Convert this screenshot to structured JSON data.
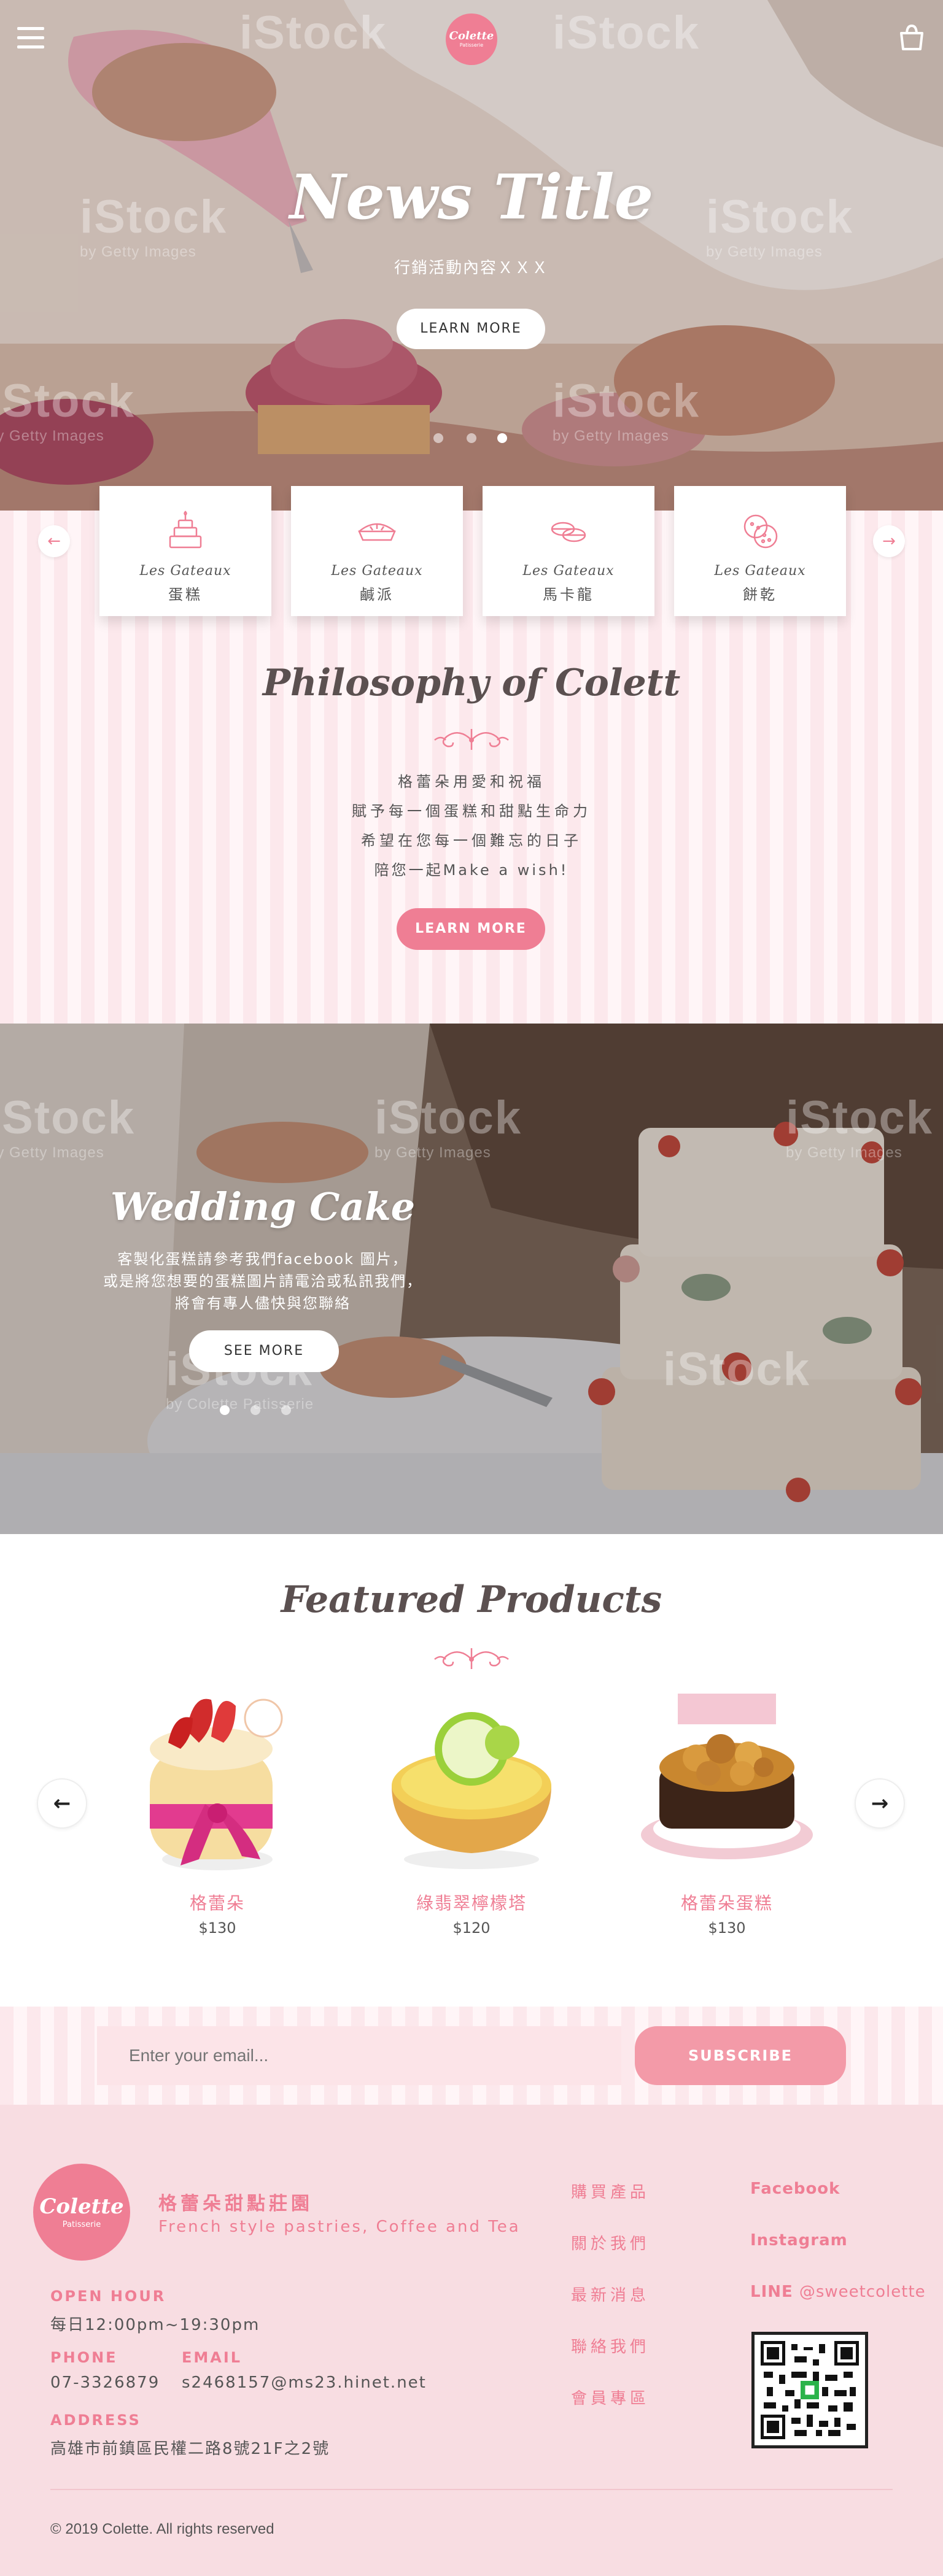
{
  "header": {
    "menu_icon": "hamburger-menu-icon",
    "logo_text": "Colette",
    "logo_sub": "Patisserie",
    "bag_icon": "shopping-bag-icon"
  },
  "hero": {
    "title": "News Title",
    "subtitle": "行銷活動內容ＸＸＸ",
    "button": "LEARN MORE",
    "watermark": "iStock",
    "watermark_sub": "by Getty Images",
    "slides": 3,
    "active_slide": 3
  },
  "categories": {
    "prev_icon": "arrow-left-icon",
    "next_icon": "arrow-right-icon",
    "items": [
      {
        "fr": "Les Gateaux",
        "zh": "蛋糕",
        "icon": "cake-icon"
      },
      {
        "fr": "Les Gateaux",
        "zh": "鹹派",
        "icon": "pie-icon"
      },
      {
        "fr": "Les Gateaux",
        "zh": "馬卡龍",
        "icon": "macaron-icon"
      },
      {
        "fr": "Les Gateaux",
        "zh": "餅乾",
        "icon": "cookie-icon"
      }
    ]
  },
  "philosophy": {
    "title": "Philosophy of Colett",
    "lines": [
      "格蕾朵用愛和祝福",
      "賦予每一個蛋糕和甜點生命力",
      "希望在您每一個難忘的日子",
      "陪您一起Make a wish!"
    ],
    "button": "LEARN MORE"
  },
  "wedding": {
    "title": "Wedding Cake",
    "lines": [
      "客製化蛋糕請參考我們facebook 圖片，",
      "或是將您想要的蛋糕圖片請電洽或私訊我們，",
      "將會有專人儘快與您聯絡"
    ],
    "button": "SEE MORE",
    "watermark_caption": "by Colette Patisserie",
    "slides": 3,
    "active_slide": 1
  },
  "featured": {
    "title": "Featured Products",
    "prev_icon": "arrow-left-icon",
    "next_icon": "arrow-right-icon",
    "products": [
      {
        "name": "格蕾朵",
        "price": "$130"
      },
      {
        "name": "綠翡翠檸檬塔",
        "price": "$120"
      },
      {
        "name": "格蕾朵蛋糕",
        "price": "$130"
      }
    ]
  },
  "subscribe": {
    "placeholder": "Enter your email...",
    "button": "SUBSCRIBE"
  },
  "footer": {
    "logo_text": "Colette",
    "logo_sub": "Patisserie",
    "brand_name": "格蕾朵甜點莊園",
    "brand_tagline": "French style pastries, Coffee and Tea",
    "open_hour_label": "OPEN HOUR",
    "open_hour": "每日12:00pm~19:30pm",
    "phone_label": "PHONE",
    "phone": "07-3326879",
    "email_label": "EMAIL",
    "email": "s2468157@ms23.hinet.net",
    "address_label": "ADDRESS",
    "address": "高雄市前鎮區民權二路8號21F之2號",
    "nav": [
      "購買產品",
      "關於我們",
      "最新消息",
      "聯絡我們",
      "會員專區"
    ],
    "social": {
      "facebook": "Facebook",
      "instagram": "Instagram",
      "line_label": "LINE",
      "line_id": "@sweetcolette"
    },
    "copyright": "© 2019 Colette. All rights reserved"
  },
  "colors": {
    "accent": "#ef7e94",
    "pink_bg": "#fbe4e8",
    "footer_bg": "#f8dde2",
    "text": "#555555"
  }
}
